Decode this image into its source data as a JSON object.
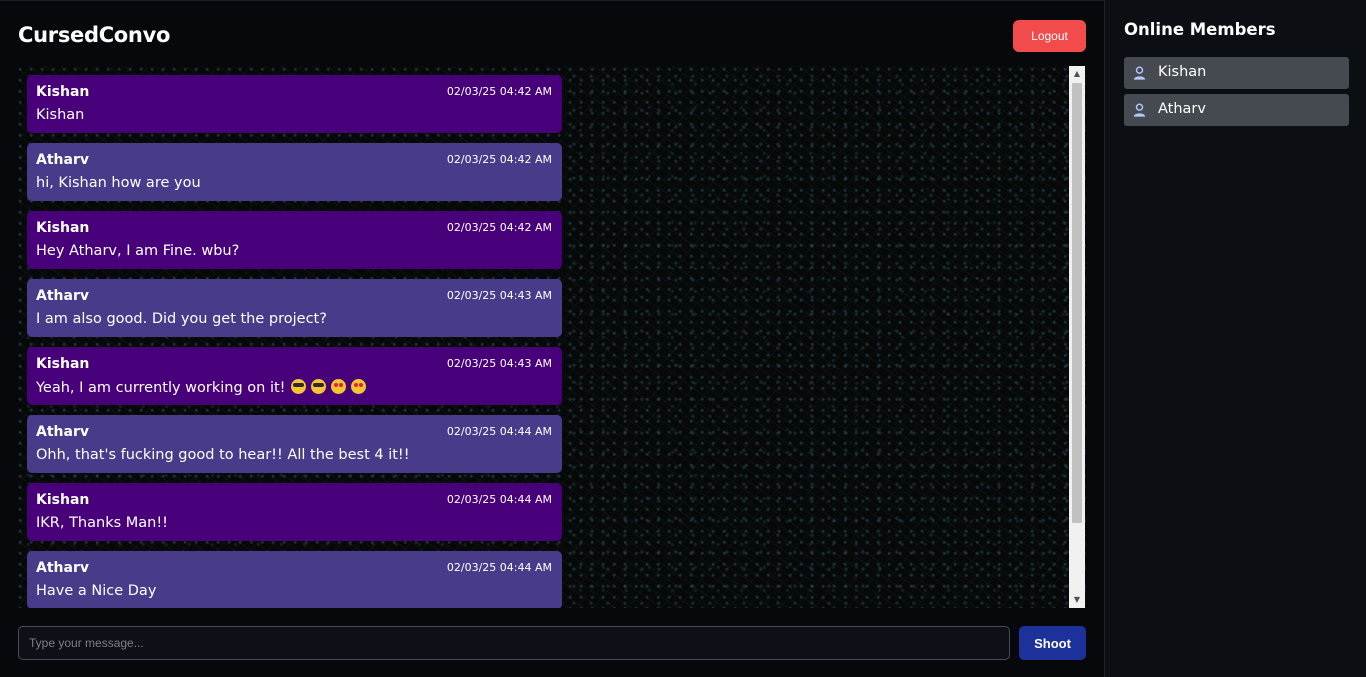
{
  "header": {
    "title": "CursedConvo",
    "logout_label": "Logout"
  },
  "messages": [
    {
      "sender": "Kishan",
      "time": "02/03/25 04:42 AM",
      "text": "Kishan",
      "emojis": []
    },
    {
      "sender": "Atharv",
      "time": "02/03/25 04:42 AM",
      "text": "hi, Kishan how are you",
      "emojis": []
    },
    {
      "sender": "Kishan",
      "time": "02/03/25 04:42 AM",
      "text": "Hey Atharv, I am Fine. wbu?",
      "emojis": []
    },
    {
      "sender": "Atharv",
      "time": "02/03/25 04:43 AM",
      "text": "I am also good. Did you get the project?",
      "emojis": []
    },
    {
      "sender": "Kishan",
      "time": "02/03/25 04:43 AM",
      "text": "Yeah, I am currently working on it!",
      "emojis": [
        "smiling-face-with-sunglasses",
        "smiling-face-with-sunglasses",
        "star-struck",
        "star-struck"
      ]
    },
    {
      "sender": "Atharv",
      "time": "02/03/25 04:44 AM",
      "text": "Ohh, that's fucking good to hear!! All the best 4 it!!",
      "emojis": []
    },
    {
      "sender": "Kishan",
      "time": "02/03/25 04:44 AM",
      "text": "IKR, Thanks Man!!",
      "emojis": []
    },
    {
      "sender": "Atharv",
      "time": "02/03/25 04:44 AM",
      "text": "Have a Nice Day",
      "emojis": []
    }
  ],
  "composer": {
    "placeholder": "Type your message...",
    "value": "",
    "send_label": "Shoot"
  },
  "sidebar": {
    "title": "Online Members",
    "members": [
      {
        "name": "Kishan",
        "icon": "user-icon"
      },
      {
        "name": "Atharv",
        "icon": "user-icon"
      }
    ]
  },
  "colors": {
    "kishan_bubble": "#48007a",
    "atharv_bubble": "#483c8a",
    "logout": "#f14b4b",
    "send": "#1c3199",
    "member_bg": "#454a51"
  }
}
